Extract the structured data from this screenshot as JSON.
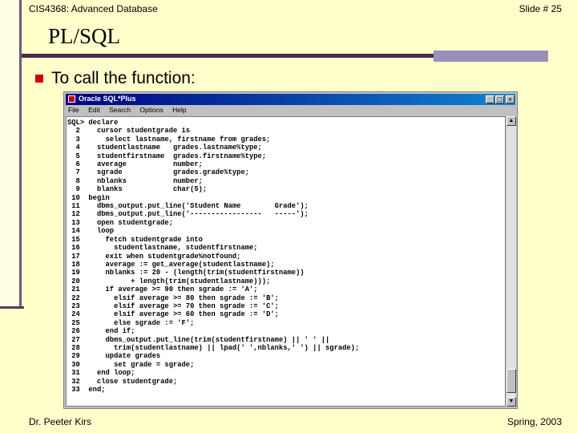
{
  "header": {
    "course": "CIS4368: Advanced Database",
    "slide_number": "Slide # 25"
  },
  "title": "PL/SQL",
  "bullet": {
    "text": "To call the function:",
    "color": "#d00000"
  },
  "window": {
    "title": "Oracle SQL*Plus",
    "menus": [
      "File",
      "Edit",
      "Search",
      "Options",
      "Help"
    ],
    "buttons": {
      "minimize": "_",
      "maximize": "□",
      "close": "×"
    },
    "code_lines": [
      "SQL> declare",
      "  2    cursor studentgrade is",
      "  3      select lastname, firstname from grades;",
      "  4    studentlastname   grades.lastname%type;",
      "  5    studentfirstname  grades.firstname%type;",
      "  6    average           number;",
      "  7    sgrade            grades.grade%type;",
      "  8    nblanks           number;",
      "  9    blanks            char(5);",
      " 10  begin",
      " 11    dbms_output.put_line('Student Name        Grade');",
      " 12    dbms_output.put_line('-----------------   -----');",
      " 13    open studentgrade;",
      " 14    loop",
      " 15      fetch studentgrade into",
      " 16        studentlastname, studentfirstname;",
      " 17      exit when studentgrade%notfound;",
      " 18      average := get_average(studentlastname);",
      " 19      nblanks := 20 - (length(trim(studentfirstname))",
      " 20            + length(trim(studentlastname)));",
      " 21      if average >= 90 then sgrade := 'A';",
      " 22        elsif average >= 80 then sgrade := 'B';",
      " 23        elsif average >= 70 then sgrade := 'C';",
      " 24        elsif average >= 60 then sgrade := 'D';",
      " 25        else sgrade := 'F';",
      " 26      end if;",
      " 27      dbms_output.put_line(trim(studentfirstname) || ' ' ||",
      " 28        trim(studentlastname) || lpad(' ',nblanks,' ') || sgrade);",
      " 29      update grades",
      " 30        set grade = sgrade;",
      " 31    end loop;",
      " 32    close studentgrade;",
      " 33  end;"
    ]
  },
  "footer": {
    "author": "Dr. Peeter Kirs",
    "term": "Spring, 2003"
  }
}
